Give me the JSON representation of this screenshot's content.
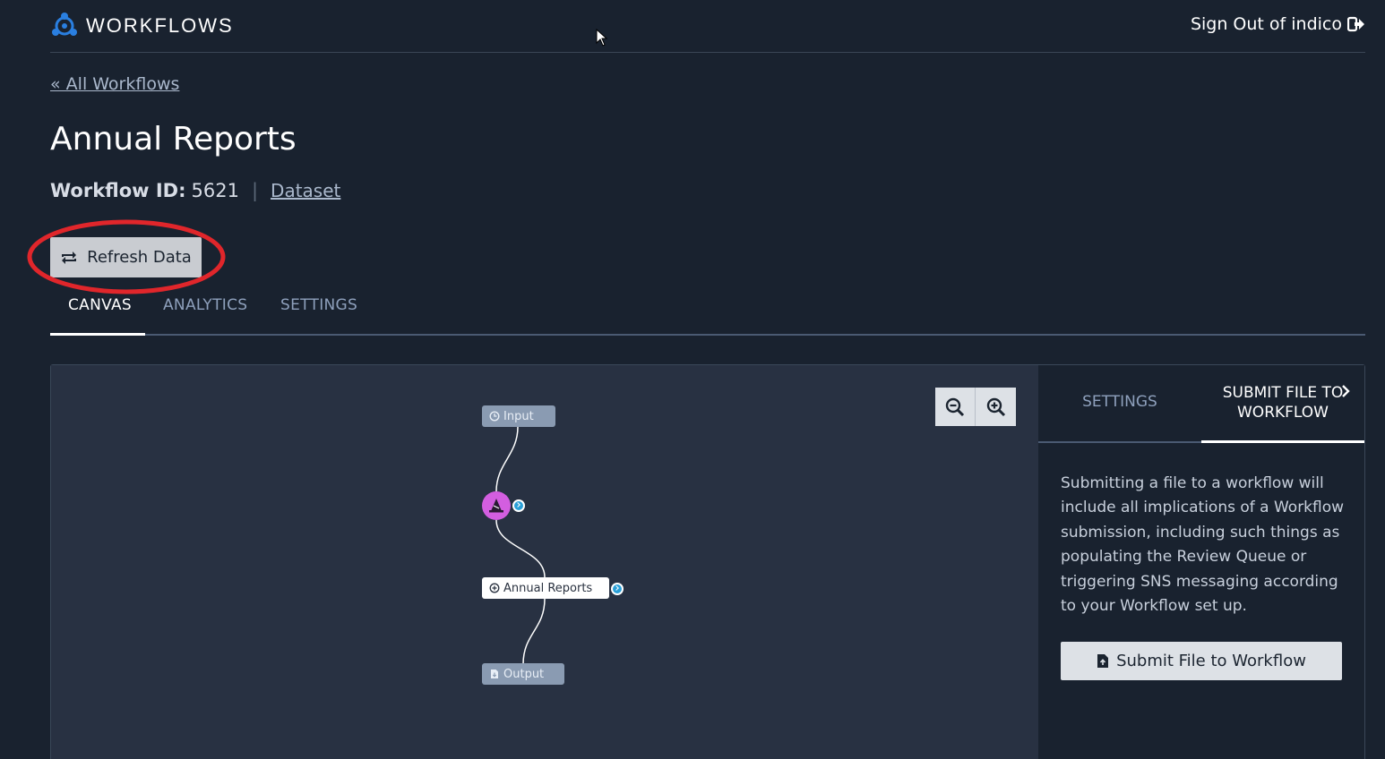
{
  "header": {
    "app_name": "WORKFLOWS",
    "signout_label": "Sign Out of indico",
    "logo_icon": "indico-logo-icon",
    "signout_icon": "sign-out-icon"
  },
  "breadcrumb": {
    "back_label": "« All Workflows"
  },
  "page": {
    "title": "Annual Reports",
    "workflow_id_label": "Workflow ID:",
    "workflow_id_value": "5621",
    "dataset_label": "Dataset"
  },
  "refresh_button": {
    "label": "Refresh Data",
    "icon": "refresh-icon"
  },
  "tabs": [
    {
      "label": "CANVAS",
      "active": true
    },
    {
      "label": "ANALYTICS",
      "active": false
    },
    {
      "label": "SETTINGS",
      "active": false
    }
  ],
  "canvas": {
    "nodes": {
      "input": "Input",
      "model": "Annual Reports",
      "output": "Output"
    },
    "zoom_out_icon": "zoom-out-icon",
    "zoom_in_icon": "zoom-in-icon"
  },
  "side_panel": {
    "tabs": [
      {
        "label": "SETTINGS",
        "active": false
      },
      {
        "label": "SUBMIT FILE TO WORKFLOW",
        "line1": "SUBMIT FILE TO",
        "line2": "WORKFLOW",
        "active": true
      }
    ],
    "description": "Submitting a file to a workflow will include all implications of a Workflow submission, including such things as populating the Review Queue or triggering SNS messaging according to your Workflow set up.",
    "submit_label": "Submit File to Workflow"
  },
  "colors": {
    "background": "#19222f",
    "canvas": "#283142",
    "model_node": "#d35ee0",
    "highlight": "#e0262b",
    "link": "#aab8cc"
  }
}
